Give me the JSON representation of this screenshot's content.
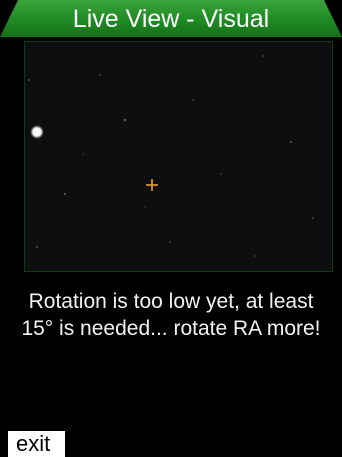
{
  "header": {
    "title": "Live View - Visual",
    "color": "#1f8a24"
  },
  "live_view": {
    "icon": "crosshair-icon",
    "crosshair_color": "#e9a23a"
  },
  "status": {
    "message": "Rotation is too low yet, at least 15° is needed... rotate RA more!"
  },
  "footer": {
    "exit_label": "exit"
  }
}
